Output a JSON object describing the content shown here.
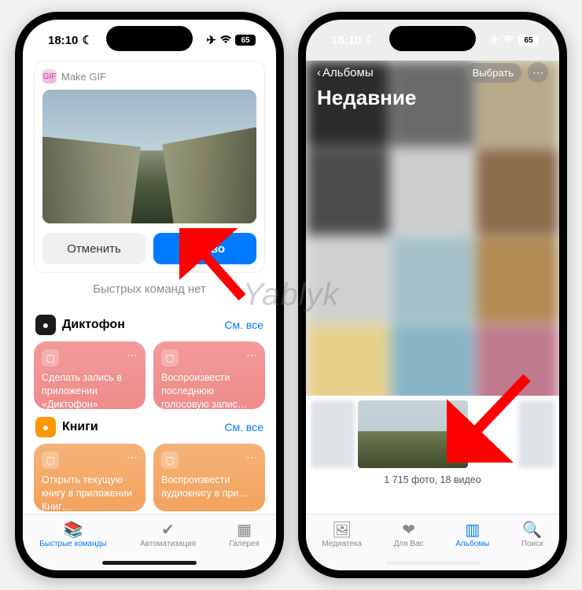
{
  "status": {
    "time": "18:10",
    "battery": "65"
  },
  "left": {
    "card_app": "Make GIF",
    "cancel": "Отменить",
    "done": "Готово",
    "empty": "Быстрых команд нет",
    "sections": [
      {
        "icon_bg": "#1c1c1e",
        "title": "Диктофон",
        "see_all": "См. все",
        "tile_class": "red-tile",
        "tiles": [
          "Сделать запись в приложении «Диктофон»",
          "Воспроизвести последнюю голосовую запис…"
        ]
      },
      {
        "icon_bg": "#ff9500",
        "title": "Книги",
        "see_all": "См. все",
        "tile_class": "orange-tile",
        "tiles": [
          "Открыть текущую книгу в приложении Книг…",
          "Воспроизвести аудиокнигу в при…"
        ]
      }
    ],
    "tabs": [
      {
        "icon": "📚",
        "label": "Быстрые команды",
        "active": true
      },
      {
        "icon": "✔︎",
        "label": "Автоматизация",
        "active": false
      },
      {
        "icon": "▦",
        "label": "Галерея",
        "active": false
      }
    ]
  },
  "right": {
    "back": "Альбомы",
    "title": "Недавние",
    "select": "Выбрать",
    "count": "1 715 фото, 18 видео",
    "blur_colors": [
      "#2b2b2b",
      "#6a6a6a",
      "#b7a98a",
      "#4b4b4b",
      "#cfcfcf",
      "#8a6b4a",
      "#d0d0d0",
      "#a4c0c8",
      "#b18a54",
      "#e6d08a",
      "#88b4c6",
      "#c07a8e",
      "#f0f0f0",
      "#cce0e8",
      "#d8b060"
    ],
    "tabs": [
      {
        "icon": "🖼",
        "label": "Медиатека",
        "active": false
      },
      {
        "icon": "❤︎",
        "label": "Для Вас",
        "active": false
      },
      {
        "icon": "▥",
        "label": "Альбомы",
        "active": true
      },
      {
        "icon": "🔍",
        "label": "Поиск",
        "active": false
      }
    ]
  },
  "watermark": "Yablyk"
}
